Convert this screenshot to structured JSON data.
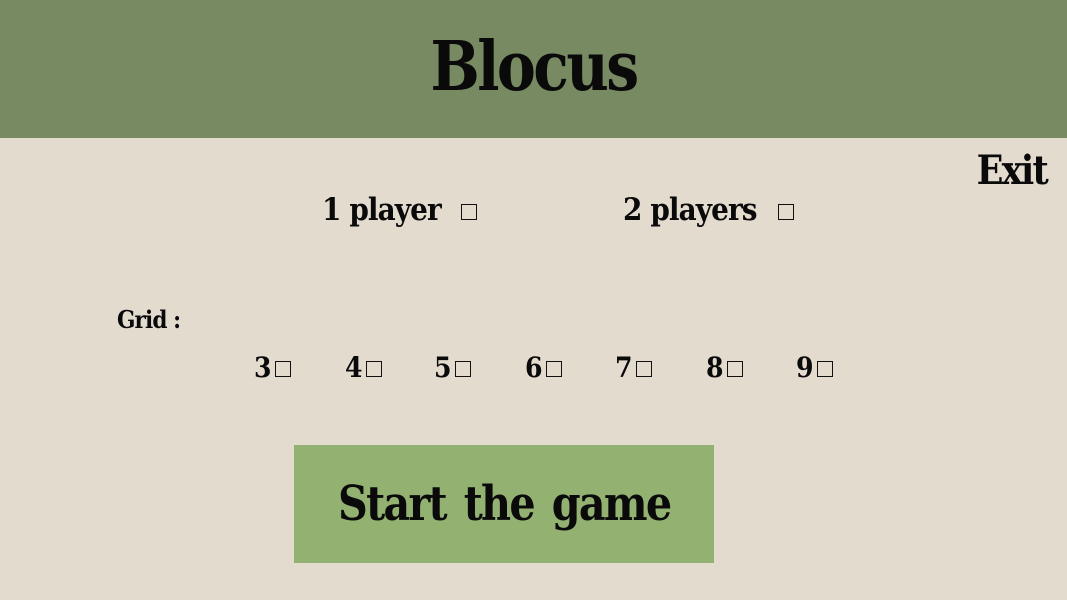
{
  "header": {
    "title": "Blocus",
    "background_color": "#778a62"
  },
  "exit_label": "Exit",
  "players": {
    "options": [
      {
        "label": "1  player",
        "checked": false
      },
      {
        "label": "2  players",
        "checked": false
      }
    ]
  },
  "grid": {
    "label": "Grid  :",
    "options": [
      {
        "label": "3",
        "checked": false
      },
      {
        "label": "4",
        "checked": false
      },
      {
        "label": "5",
        "checked": false
      },
      {
        "label": "6",
        "checked": false
      },
      {
        "label": "7",
        "checked": false
      },
      {
        "label": "8",
        "checked": false
      },
      {
        "label": "9",
        "checked": false
      }
    ]
  },
  "start_button": {
    "label": "Start  the  game",
    "background_color": "#93b272"
  },
  "page_background": "#e4dbcf"
}
